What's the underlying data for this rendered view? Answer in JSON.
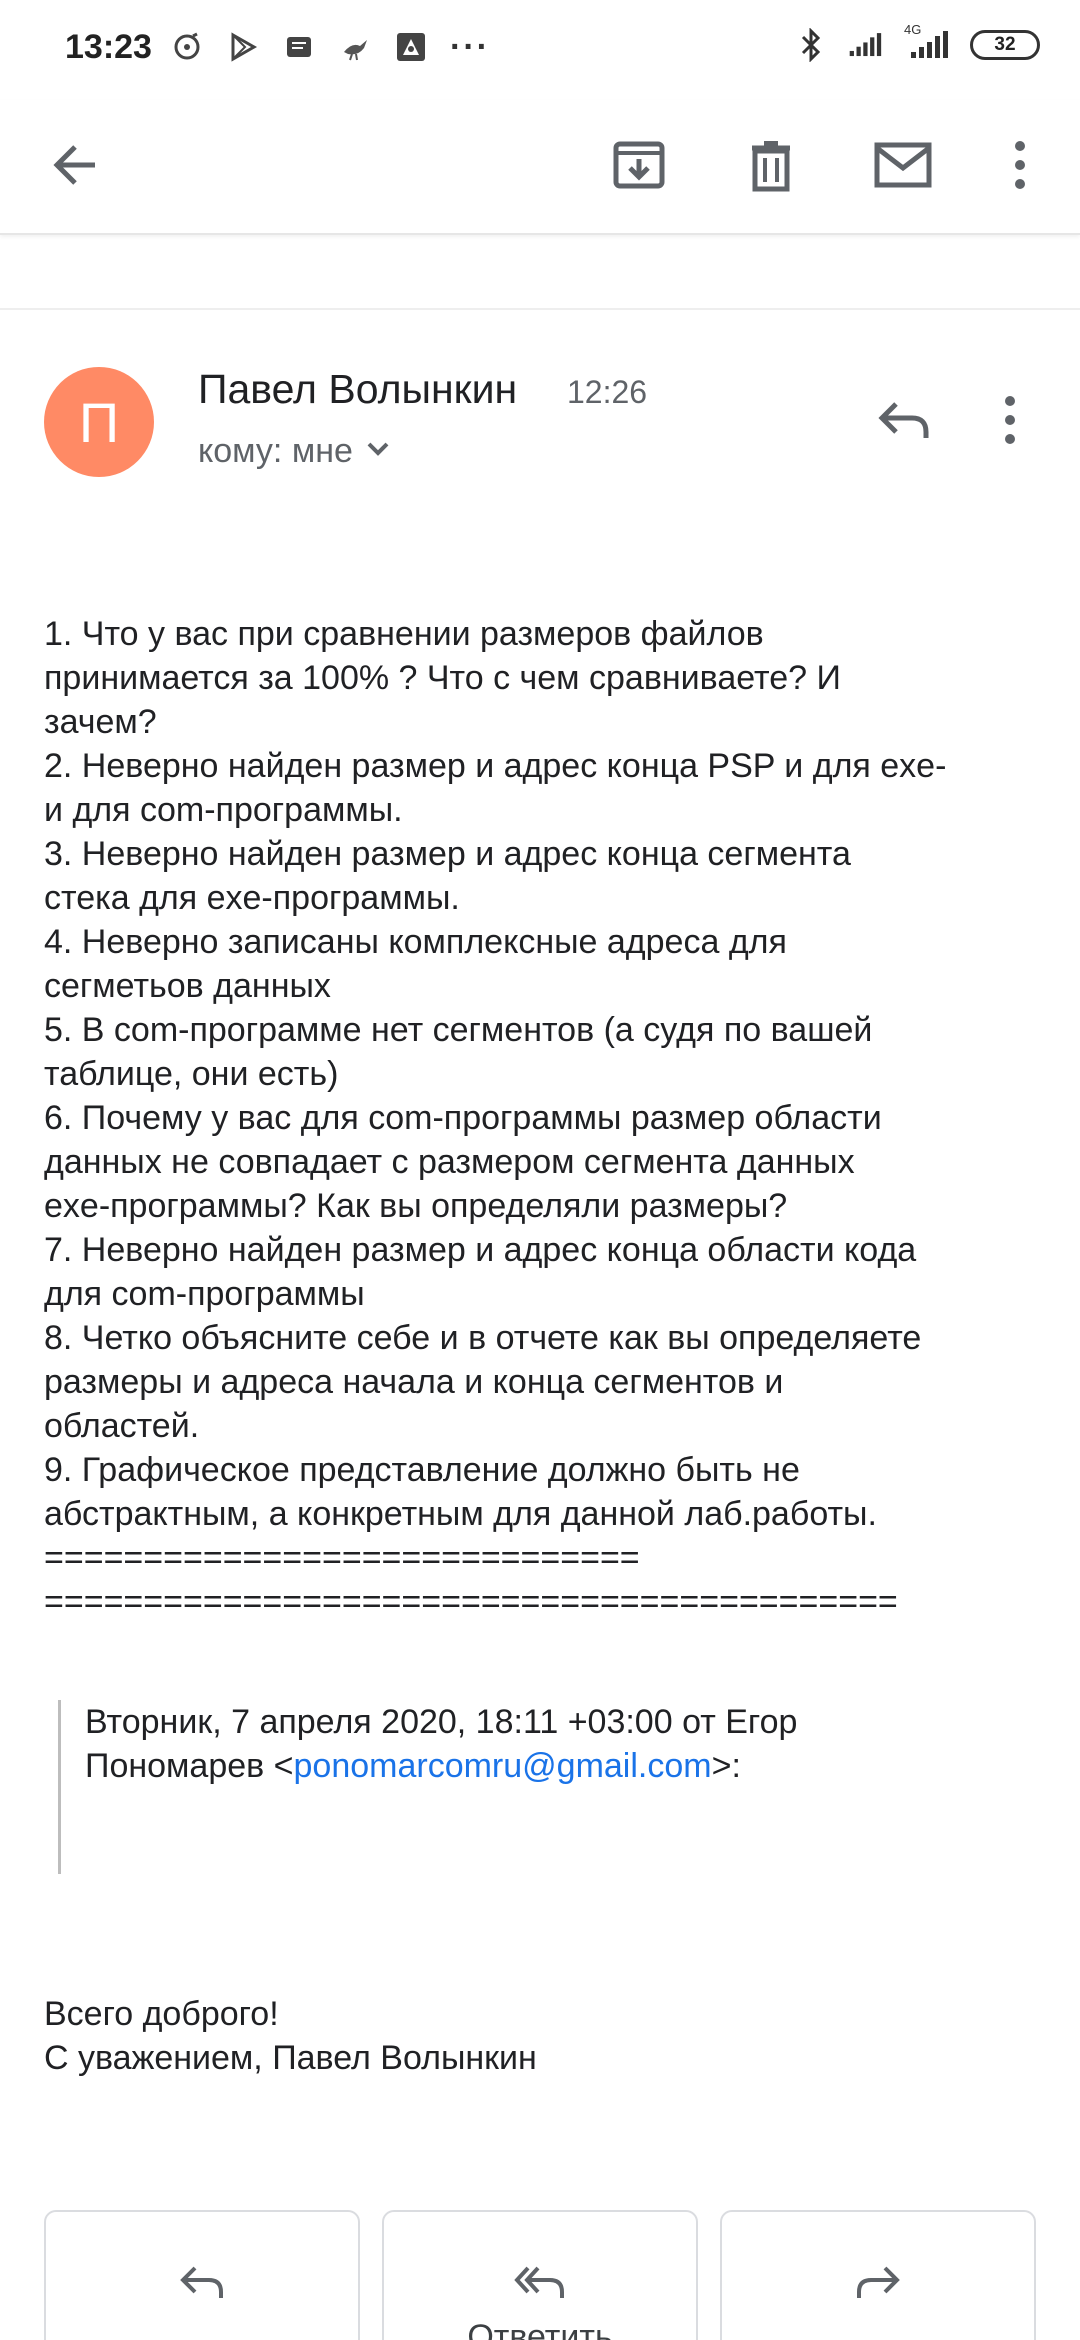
{
  "status_bar": {
    "time": "13:23",
    "dots": "···",
    "network": "4G",
    "battery": "32"
  },
  "toolbar": {
    "back": "arrow-back-icon",
    "archive": "archive-icon",
    "delete": "trash-icon",
    "mark_unread": "mail-icon",
    "more": "more-vert-icon"
  },
  "message": {
    "avatar_letter": "П",
    "avatar_color": "#ff8a65",
    "sender": "Павел Волынкин",
    "time": "12:26",
    "recipient_label": "кому: мне",
    "body_lines": [
      "1. Что у вас при сравнении размеров файлов",
      "принимается за 100% ? Что с чем сравниваете? И",
      "зачем?",
      "2. Неверно найден размер и адрес конца PSP и для exe-",
      "и для com-программы.",
      "3. Неверно найден размер и адрес конца сегмента",
      "стека для exe-программы.",
      "4. Неверно записаны комплексные адреса для",
      "сегметьов данных",
      "5. В com-программе нет сегментов (а судя по вашей",
      "таблице, они есть)",
      "6. Почему у вас для com-программы размер области",
      "данных не совпадает с размером сегмента данных",
      "exe-программы? Как вы определяли размеры?",
      "7. Неверно найден размер и адрес конца области кода",
      "для com-программы",
      "8. Четко объясните себе и в отчете как вы определяете",
      "размеры и адреса начала и конца сегментов и",
      "областей.",
      "9. Графическое представление должно быть не",
      "абстрактным, а конкретным для данной лаб.работы.",
      "==============================",
      "==========================================="
    ],
    "quote": {
      "line1": "Вторник, 7 апреля 2020, 18:11 +03:00 от Егор",
      "line2_prefix": "Пономарев <",
      "email": "ponomarcomru@gmail.com",
      "line2_suffix": ">:"
    },
    "signature": {
      "line1": "Всего доброго!",
      "line2": "С уважением, Павел Волынкин"
    }
  },
  "actions": {
    "reply_all_label": "Ответить"
  },
  "colors": {
    "link": "#1a73e8",
    "icon": "#5f6368"
  }
}
